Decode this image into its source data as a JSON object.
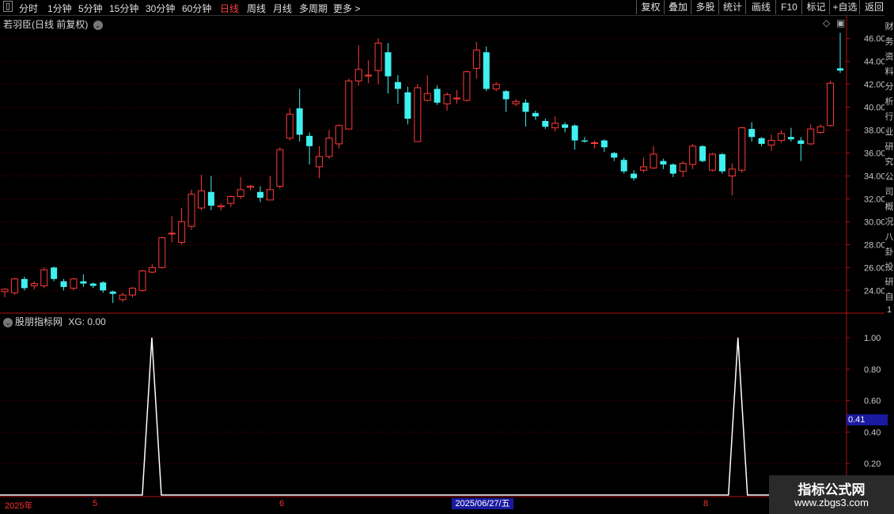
{
  "toolbar": {
    "left_items": [
      "分时",
      "1分钟",
      "5分钟",
      "15分钟",
      "30分钟",
      "60分钟",
      "日线",
      "周线",
      "月线",
      "多周期",
      "更多 >"
    ],
    "active_item": "日线",
    "right_items": [
      "复权",
      "叠加",
      "多股",
      "统计",
      "画线",
      "F10",
      "标记",
      "+自选",
      "返回"
    ]
  },
  "main_panel": {
    "title": "若羽臣(日线 前复权)",
    "y_ticks": [
      "46.00",
      "44.00",
      "42.00",
      "40.00",
      "38.00",
      "36.00",
      "34.00",
      "32.00",
      "30.00",
      "28.00",
      "26.00",
      "24.00"
    ]
  },
  "indicator_panel": {
    "title": "股朋指标网",
    "value_label": "XG: 0.00",
    "y_ticks": [
      "1.00",
      "0.80",
      "0.60",
      "0.40",
      "0.20"
    ],
    "current_value": "0.41"
  },
  "date_axis": {
    "labels": [
      "2025年",
      "5",
      "6",
      "8"
    ],
    "highlight": "2025/06/27/五"
  },
  "watermark": {
    "title": "指标公式网",
    "url": "www.zbgs3.com"
  },
  "right_strip_chars": [
    "财",
    "务",
    "资",
    "料",
    "分",
    "析",
    "行",
    "业",
    "研",
    "究",
    "公",
    "司",
    "概",
    "况",
    "八",
    "卦",
    "投",
    "研",
    "自",
    "1"
  ],
  "chart_data": {
    "type": "candlestick",
    "ylim": [
      22.5,
      47.5
    ],
    "candles": [
      [
        23.9,
        24.1,
        23.4,
        24.2
      ],
      [
        23.8,
        25.0,
        23.6,
        25.1
      ],
      [
        25.0,
        24.2,
        24.0,
        25.2
      ],
      [
        24.4,
        24.6,
        24.1,
        24.8
      ],
      [
        24.4,
        25.8,
        24.2,
        26.0
      ],
      [
        26.0,
        25.0,
        24.8,
        26.1
      ],
      [
        24.8,
        24.3,
        24.0,
        25.0
      ],
      [
        24.2,
        25.0,
        24.0,
        25.1
      ],
      [
        24.8,
        24.6,
        24.3,
        25.4
      ],
      [
        24.6,
        24.4,
        24.2,
        24.7
      ],
      [
        24.7,
        24.0,
        23.8,
        24.8
      ],
      [
        23.9,
        23.7,
        22.9,
        24.0
      ],
      [
        23.2,
        23.6,
        23.0,
        23.8
      ],
      [
        23.6,
        24.2,
        23.4,
        24.3
      ],
      [
        24.0,
        25.7,
        23.9,
        25.8
      ],
      [
        25.6,
        26.0,
        25.5,
        26.3
      ],
      [
        26.0,
        28.6,
        25.9,
        28.7
      ],
      [
        29.0,
        29.0,
        28.2,
        30.5
      ],
      [
        28.2,
        30.0,
        28.0,
        31.2
      ],
      [
        29.6,
        32.4,
        29.3,
        32.8
      ],
      [
        31.2,
        32.7,
        31.0,
        34.1
      ],
      [
        32.6,
        31.4,
        31.0,
        34.0
      ],
      [
        31.3,
        31.4,
        31.0,
        31.6
      ],
      [
        31.6,
        32.2,
        31.3,
        32.3
      ],
      [
        32.2,
        32.8,
        32.0,
        33.9
      ],
      [
        33.0,
        33.1,
        32.7,
        33.2
      ],
      [
        32.6,
        32.1,
        31.7,
        33.1
      ],
      [
        31.9,
        32.8,
        31.9,
        34.0
      ],
      [
        33.1,
        36.3,
        32.9,
        36.5
      ],
      [
        37.3,
        39.4,
        37.1,
        39.9
      ],
      [
        39.9,
        37.6,
        37.0,
        41.6
      ],
      [
        37.5,
        36.6,
        35.0,
        37.8
      ],
      [
        34.8,
        35.7,
        33.8,
        36.6
      ],
      [
        35.7,
        37.3,
        35.5,
        38.0
      ],
      [
        36.8,
        38.4,
        36.4,
        38.5
      ],
      [
        38.1,
        42.3,
        38.1,
        42.5
      ],
      [
        42.3,
        43.3,
        41.9,
        45.4
      ],
      [
        42.8,
        42.8,
        42.1,
        44.1
      ],
      [
        43.2,
        45.6,
        42.0,
        46.0
      ],
      [
        44.8,
        42.7,
        41.2,
        45.6
      ],
      [
        42.2,
        41.6,
        40.3,
        42.8
      ],
      [
        41.3,
        39.0,
        38.5,
        41.8
      ],
      [
        37.0,
        41.7,
        37.0,
        42.0
      ],
      [
        40.6,
        41.2,
        40.5,
        42.8
      ],
      [
        41.6,
        40.4,
        40.2,
        41.9
      ],
      [
        40.3,
        41.1,
        39.7,
        41.3
      ],
      [
        40.8,
        40.8,
        40.3,
        41.5
      ],
      [
        40.6,
        43.1,
        40.5,
        43.2
      ],
      [
        43.4,
        45.0,
        42.5,
        45.7
      ],
      [
        44.8,
        41.6,
        41.4,
        45.3
      ],
      [
        41.6,
        42.0,
        41.4,
        42.2
      ],
      [
        41.4,
        40.7,
        39.6,
        41.5
      ],
      [
        40.3,
        40.5,
        40.1,
        40.7
      ],
      [
        40.4,
        39.6,
        38.3,
        40.7
      ],
      [
        39.5,
        39.2,
        38.9,
        39.7
      ],
      [
        38.8,
        38.3,
        38.1,
        39.0
      ],
      [
        38.2,
        38.6,
        37.9,
        39.2
      ],
      [
        38.5,
        38.2,
        37.8,
        38.7
      ],
      [
        38.4,
        37.1,
        36.3,
        38.5
      ],
      [
        37.1,
        37.0,
        36.9,
        37.4
      ],
      [
        36.9,
        36.9,
        36.4,
        37.1
      ],
      [
        37.1,
        36.5,
        36.1,
        37.2
      ],
      [
        36.0,
        35.6,
        35.3,
        36.1
      ],
      [
        35.4,
        34.4,
        34.2,
        35.6
      ],
      [
        34.2,
        33.8,
        33.6,
        34.5
      ],
      [
        34.5,
        34.8,
        34.3,
        35.6
      ],
      [
        34.7,
        35.9,
        34.6,
        36.6
      ],
      [
        35.3,
        35.0,
        34.6,
        35.5
      ],
      [
        35.0,
        34.2,
        33.9,
        35.1
      ],
      [
        34.4,
        35.1,
        33.9,
        35.3
      ],
      [
        35.0,
        36.6,
        34.6,
        36.8
      ],
      [
        36.6,
        35.3,
        35.2,
        36.7
      ],
      [
        34.5,
        35.9,
        34.4,
        36.0
      ],
      [
        35.9,
        34.4,
        34.2,
        36.0
      ],
      [
        34.0,
        34.6,
        32.3,
        35.1
      ],
      [
        34.5,
        38.2,
        34.3,
        38.3
      ],
      [
        38.1,
        37.4,
        37.0,
        38.7
      ],
      [
        37.3,
        36.8,
        36.6,
        37.4
      ],
      [
        36.7,
        37.1,
        36.2,
        37.6
      ],
      [
        37.1,
        37.7,
        36.9,
        38.0
      ],
      [
        37.4,
        37.2,
        37.0,
        38.2
      ],
      [
        37.1,
        36.8,
        35.3,
        37.4
      ],
      [
        36.8,
        38.1,
        36.7,
        38.5
      ],
      [
        37.8,
        38.3,
        37.7,
        38.5
      ],
      [
        38.4,
        42.1,
        38.3,
        42.3
      ],
      [
        43.4,
        43.2,
        43.0,
        46.5
      ]
    ],
    "indicator": {
      "name": "XG",
      "ylim": [
        0,
        1.05
      ],
      "spikes_at_candle": [
        14,
        75
      ],
      "spike_value": 1.0
    }
  }
}
